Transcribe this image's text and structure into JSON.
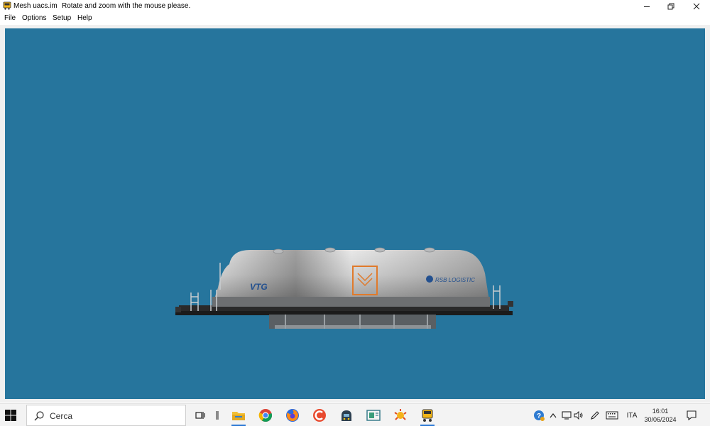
{
  "window": {
    "title": "Mesh uacs.im",
    "subtitle": "Rotate and zoom with the mouse please.",
    "controls": [
      "minimize-icon",
      "restore-icon",
      "close-icon"
    ]
  },
  "menu": {
    "file": "File",
    "options": "Options",
    "setup": "Setup",
    "help": "Help"
  },
  "viewport": {
    "background": "#26759d",
    "model": {
      "logos": {
        "left": "VTG",
        "right": "RSB LOGISTIC"
      }
    }
  },
  "taskbar": {
    "search_placeholder": "Cerca",
    "apps": [
      "task-view-icon",
      "divider-icon",
      "file-explorer-icon",
      "chrome-icon",
      "firefox-icon",
      "ccleaner-icon",
      "train-sim-icon",
      "media-icon",
      "ie-icon",
      "mesh-viewer-icon"
    ],
    "tray": {
      "language": "ITA",
      "time": "16:01",
      "date": "30/06/2024"
    }
  }
}
